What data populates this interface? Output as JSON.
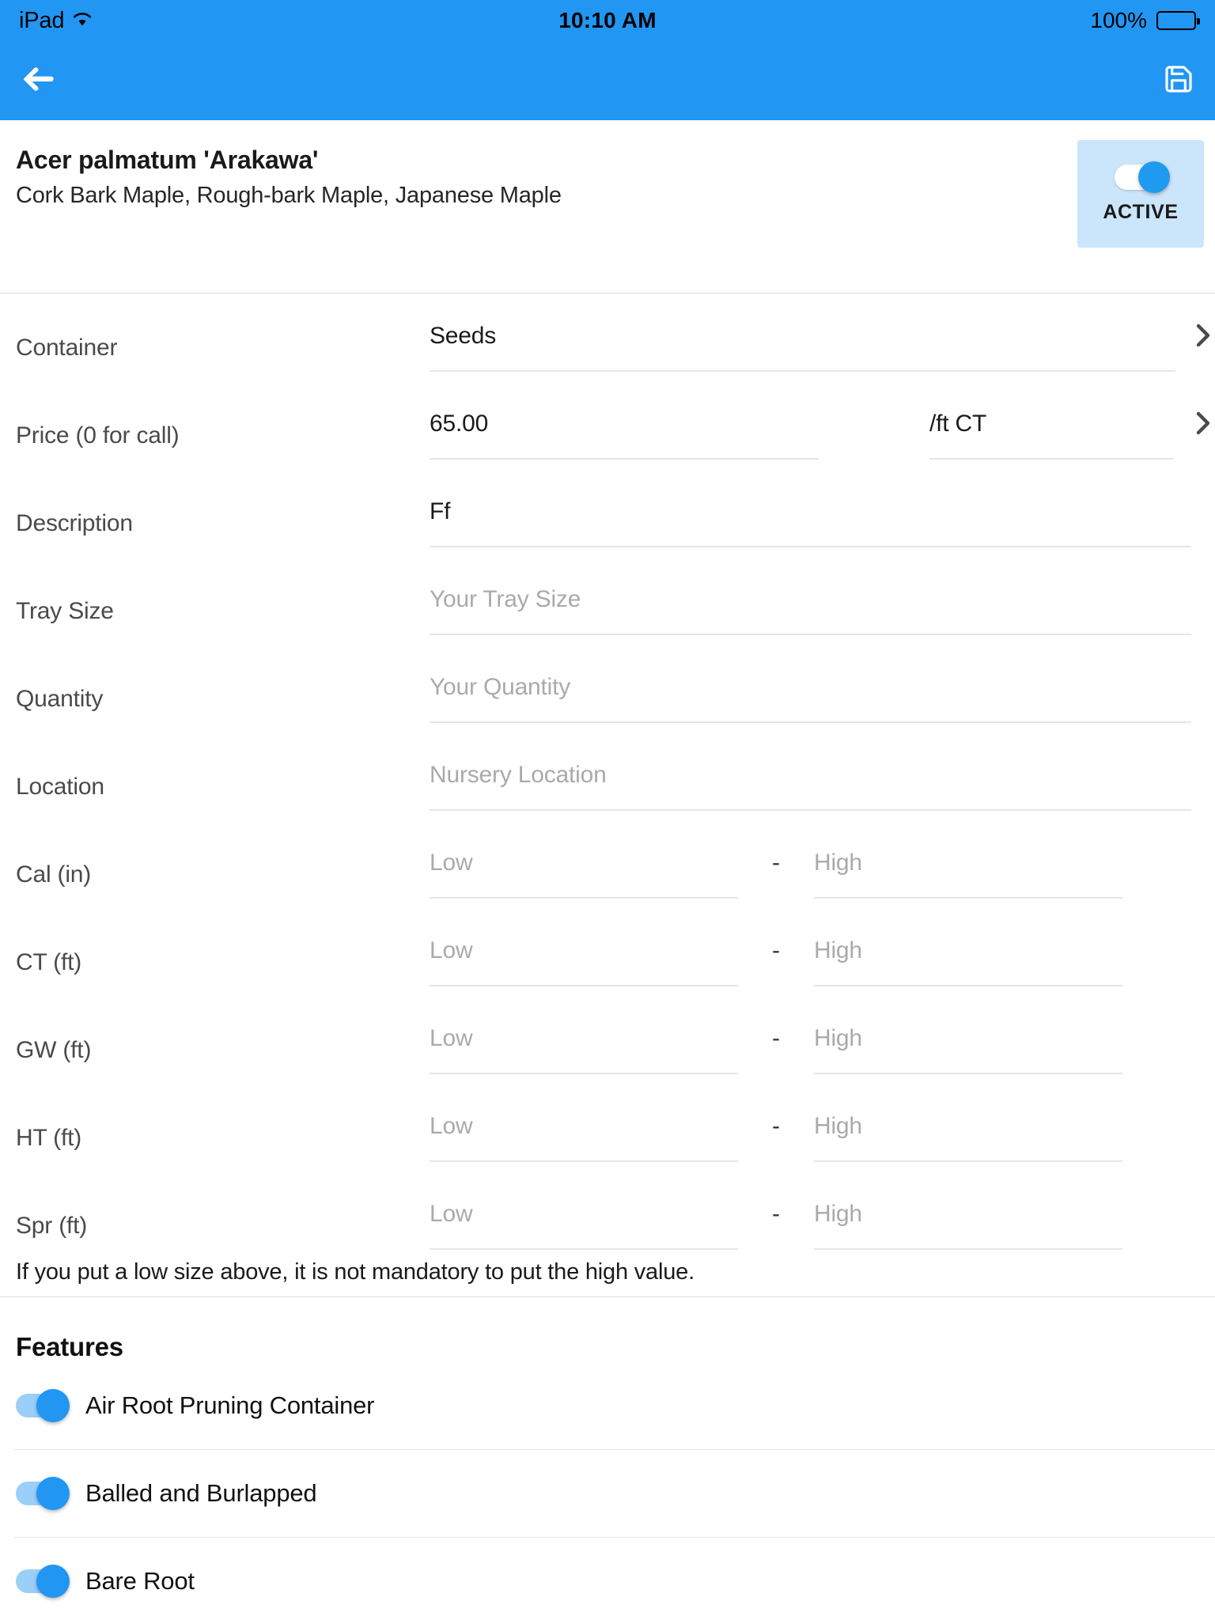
{
  "status_bar": {
    "device": "iPad",
    "wifi_icon": "wifi-icon",
    "time": "10:10 AM",
    "battery_percent": "100%",
    "battery_icon": "battery-full-icon"
  },
  "nav_bar": {
    "back_icon": "arrow-left-icon",
    "save_icon": "floppy-disk-save-icon"
  },
  "header": {
    "plant_name": "Acer palmatum 'Arakawa'",
    "common_names": "Cork Bark Maple, Rough-bark Maple, Japanese Maple",
    "active_toggle": {
      "label": "ACTIVE",
      "state": "on"
    }
  },
  "form": {
    "container": {
      "label": "Container",
      "value": "Seeds",
      "chevron_icon": "chevron-right-icon"
    },
    "price": {
      "label": "Price (0 for call)",
      "value": "65.00",
      "unit": "/ft CT",
      "chevron_icon": "chevron-right-icon"
    },
    "description": {
      "label": "Description",
      "value": "Ff"
    },
    "tray_size": {
      "label": "Tray Size",
      "placeholder": "Your Tray Size",
      "value": ""
    },
    "quantity": {
      "label": "Quantity",
      "placeholder": "Your Quantity",
      "value": ""
    },
    "location": {
      "label": "Location",
      "placeholder": "Nursery Location",
      "value": ""
    },
    "ranges": [
      {
        "label": "Cal (in)",
        "low_placeholder": "Low",
        "high_placeholder": "High",
        "separator": "-"
      },
      {
        "label": "CT (ft)",
        "low_placeholder": "Low",
        "high_placeholder": "High",
        "separator": "-"
      },
      {
        "label": "GW (ft)",
        "low_placeholder": "Low",
        "high_placeholder": "High",
        "separator": "-"
      },
      {
        "label": "HT (ft)",
        "low_placeholder": "Low",
        "high_placeholder": "High",
        "separator": "-"
      },
      {
        "label": "Spr (ft)",
        "low_placeholder": "Low",
        "high_placeholder": "High",
        "separator": "-"
      }
    ],
    "note": "If you put a low size above, it is not mandatory to put the high value."
  },
  "features": {
    "heading": "Features",
    "items": [
      {
        "label": "Air Root Pruning Container",
        "state": "on"
      },
      {
        "label": "Balled and Burlapped",
        "state": "on"
      },
      {
        "label": "Bare Root",
        "state": "on"
      }
    ]
  },
  "colors": {
    "accent": "#2196F3",
    "active_box_bg": "#CBE5FB",
    "switch_track_on": "#9BCFF7",
    "placeholder": "#AAAAAA",
    "underline": "#E6E6E6"
  }
}
